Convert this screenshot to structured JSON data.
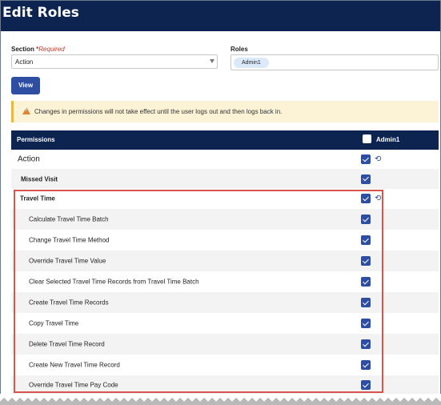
{
  "page": {
    "title": "Edit Roles"
  },
  "section": {
    "label": "Section",
    "required_star": "*",
    "required_text": "Required",
    "value": "Action"
  },
  "roles": {
    "label": "Roles",
    "chip": "Admin1"
  },
  "view_button": {
    "label": "View"
  },
  "notice": {
    "text": "Changes in permissions will not take effect until the user logs out and then logs back in."
  },
  "permissions_header": {
    "label": "Permissions",
    "role_column": "Admin1"
  },
  "rows": [
    {
      "label": "Action",
      "checked": true
    },
    {
      "label": "Missed Visit",
      "checked": true
    },
    {
      "label": "Travel Time",
      "checked": true
    },
    {
      "label": "Calculate Travel Time Batch",
      "checked": true
    },
    {
      "label": "Change Travel Time Method",
      "checked": true
    },
    {
      "label": "Override Travel Time Value",
      "checked": true
    },
    {
      "label": "Clear Selected Travel Time Records from Travel Time Batch",
      "checked": true
    },
    {
      "label": "Create Travel Time Records",
      "checked": true
    },
    {
      "label": "Copy Travel Time",
      "checked": true
    },
    {
      "label": "Delete Travel Time Record",
      "checked": true
    },
    {
      "label": "Create New Travel Time Record",
      "checked": true
    },
    {
      "label": "Override Travel Time Pay Code",
      "checked": true
    }
  ],
  "colors": {
    "header_navy": "#0d2451",
    "accent_blue": "#2d4ea3",
    "highlight_red": "#d9534f",
    "notice_bg": "#fcf2d6"
  }
}
